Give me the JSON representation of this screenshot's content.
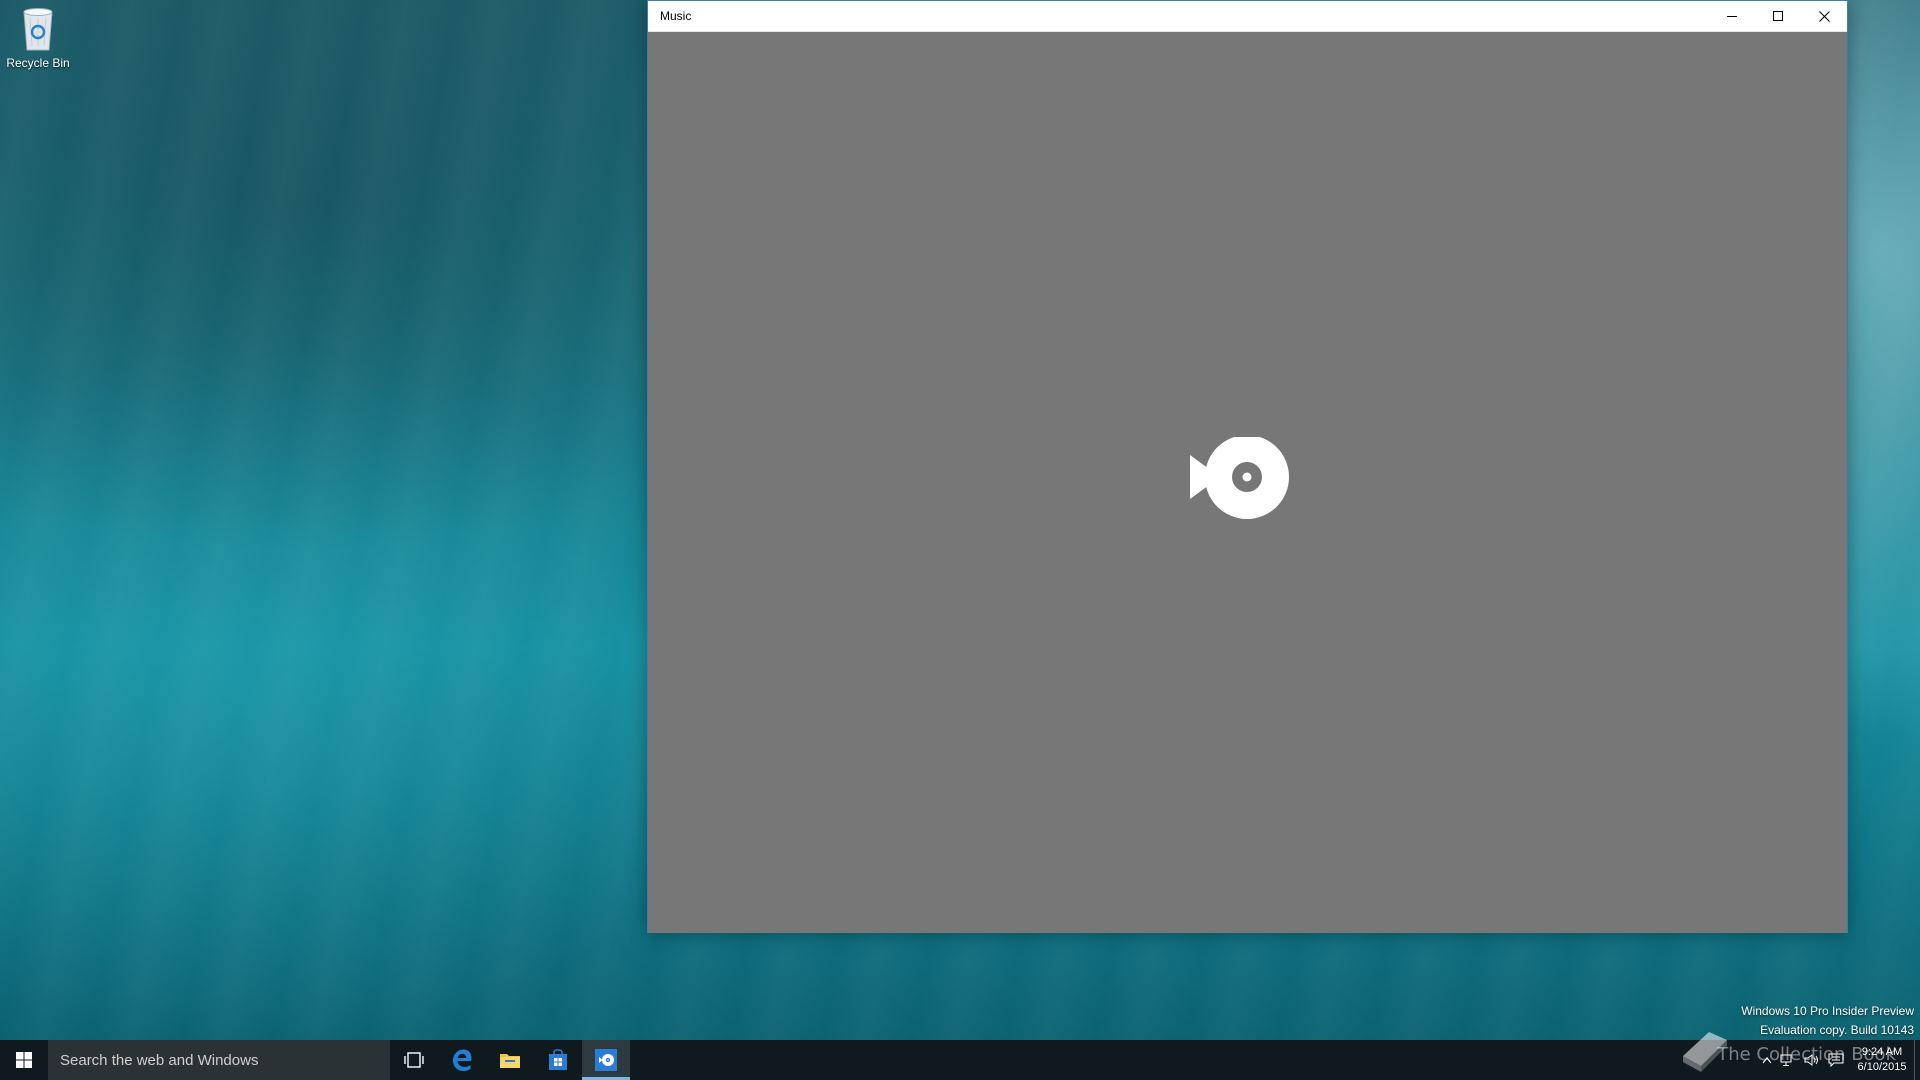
{
  "desktop": {
    "icons": [
      {
        "label": "Recycle Bin",
        "icon": "recycle-bin-icon"
      }
    ],
    "watermark": {
      "line1": "Windows 10 Pro Insider Preview",
      "line2": "Evaluation copy. Build 10143"
    }
  },
  "window": {
    "title": "Music",
    "controls": [
      "minimize",
      "maximize",
      "close"
    ],
    "content_background": "#777777",
    "splash_icon": "music-app-logo-icon"
  },
  "taskbar": {
    "start_icon": "windows-logo-icon",
    "search_placeholder": "Search the web and Windows",
    "pinned": [
      {
        "name": "task-view",
        "icon": "task-view-icon"
      },
      {
        "name": "edge",
        "icon": "edge-icon",
        "color": "#1e7fd6"
      },
      {
        "name": "file-explorer",
        "icon": "folder-icon",
        "color": "#f3c342"
      },
      {
        "name": "store",
        "icon": "store-icon",
        "color": "#2b7cd3"
      },
      {
        "name": "music",
        "icon": "music-app-icon",
        "color": "#2b7cd3",
        "active": true
      }
    ],
    "brand_text": "The Collection Book",
    "tray": {
      "icons": [
        "chevron-up-icon",
        "network-icon",
        "volume-icon",
        "action-center-icon"
      ],
      "time": "9:24 AM",
      "date": "6/10/2015"
    }
  }
}
